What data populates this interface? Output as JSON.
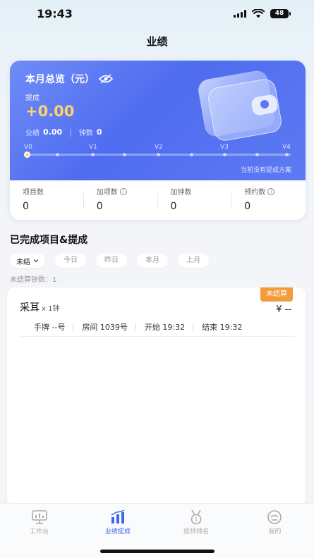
{
  "status_bar": {
    "time": "19:43",
    "battery": "48"
  },
  "nav": {
    "title": "业绩"
  },
  "overview": {
    "title": "本月总览（元）",
    "commission_label": "提成",
    "commission_value": "+0.00",
    "performance_label": "业绩",
    "performance_value": "0.00",
    "clock_label": "钟数",
    "clock_value": "0",
    "levels": [
      "V0",
      "V1",
      "V2",
      "V3",
      "V4"
    ],
    "hint": "当前没有提成方案"
  },
  "metrics": [
    {
      "label": "项目数",
      "value": "0",
      "info": false
    },
    {
      "label": "加项数",
      "value": "0",
      "info": true
    },
    {
      "label": "加钟数",
      "value": "0",
      "info": false
    },
    {
      "label": "预约数",
      "value": "0",
      "info": true
    }
  ],
  "section": {
    "title": "已完成项目&提成"
  },
  "filters": {
    "status_selected": "未结",
    "chips": [
      "今日",
      "昨日",
      "本月",
      "上月"
    ]
  },
  "pending_count_text": "未结算钟数：1",
  "record": {
    "badge": "未结算",
    "name": "采耳",
    "qty": "x 1钟",
    "amount": "¥ --",
    "details": [
      "手牌 --号",
      "房间 1039号",
      "开始 19:32",
      "结束 19:32"
    ]
  },
  "tabs": [
    {
      "label": "工作台",
      "icon": "monitor-icon"
    },
    {
      "label": "业绩提成",
      "icon": "bar-chart-icon"
    },
    {
      "label": "技师排名",
      "icon": "medal-icon"
    },
    {
      "label": "我的",
      "icon": "profile-icon"
    }
  ],
  "colors": {
    "accent": "#3e63ee",
    "gold": "#ffd36a",
    "badge": "#f39b3a"
  }
}
